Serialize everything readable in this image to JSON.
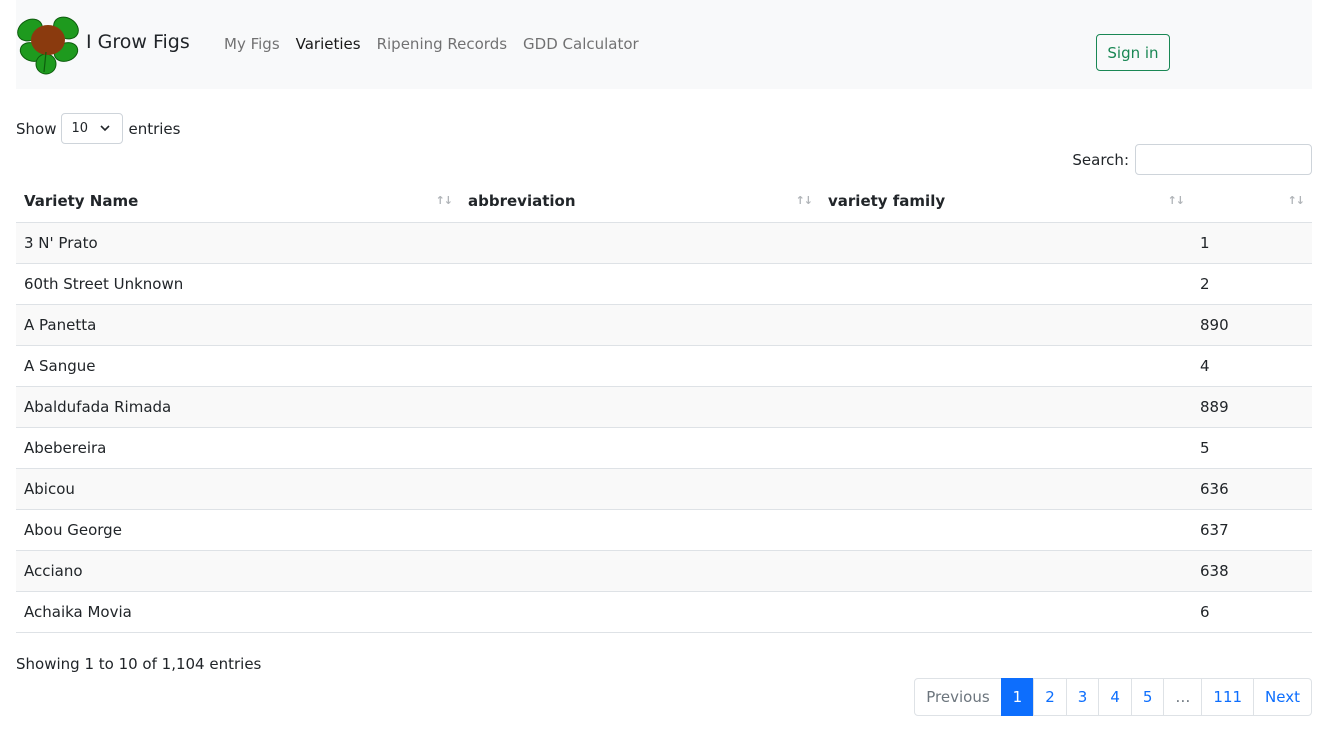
{
  "navbar": {
    "brand": "I Grow Figs",
    "links": [
      {
        "label": "My Figs",
        "active": false
      },
      {
        "label": "Varieties",
        "active": true
      },
      {
        "label": "Ripening Records",
        "active": false
      },
      {
        "label": "GDD Calculator",
        "active": false
      }
    ],
    "signin_label": "Sign in",
    "colors": {
      "success": "#198754",
      "leaf": "#1e9a1e",
      "fruit": "#8a3a0e"
    }
  },
  "length_menu": {
    "prefix": "Show",
    "selected": "10",
    "suffix": "entries"
  },
  "search": {
    "label": "Search:",
    "value": "",
    "placeholder": ""
  },
  "table": {
    "headers": [
      "Variety Name",
      "abbreviation",
      "variety family",
      ""
    ],
    "rows": [
      [
        "3 N' Prato",
        "",
        "",
        "1"
      ],
      [
        "60th Street Unknown",
        "",
        "",
        "2"
      ],
      [
        "A Panetta",
        "",
        "",
        "890"
      ],
      [
        "A Sangue",
        "",
        "",
        "4"
      ],
      [
        "Abaldufada Rimada",
        "",
        "",
        "889"
      ],
      [
        "Abebereira",
        "",
        "",
        "5"
      ],
      [
        "Abicou",
        "",
        "",
        "636"
      ],
      [
        "Abou George",
        "",
        "",
        "637"
      ],
      [
        "Acciano",
        "",
        "",
        "638"
      ],
      [
        "Achaika Movia",
        "",
        "",
        "6"
      ]
    ]
  },
  "info": "Showing 1 to 10 of 1,104 entries",
  "pagination": {
    "items": [
      {
        "label": "Previous",
        "state": "disabled"
      },
      {
        "label": "1",
        "state": "active"
      },
      {
        "label": "2",
        "state": ""
      },
      {
        "label": "3",
        "state": ""
      },
      {
        "label": "4",
        "state": ""
      },
      {
        "label": "5",
        "state": ""
      },
      {
        "label": "…",
        "state": "disabled"
      },
      {
        "label": "111",
        "state": ""
      },
      {
        "label": "Next",
        "state": ""
      }
    ],
    "accent": "#0d6efd"
  }
}
